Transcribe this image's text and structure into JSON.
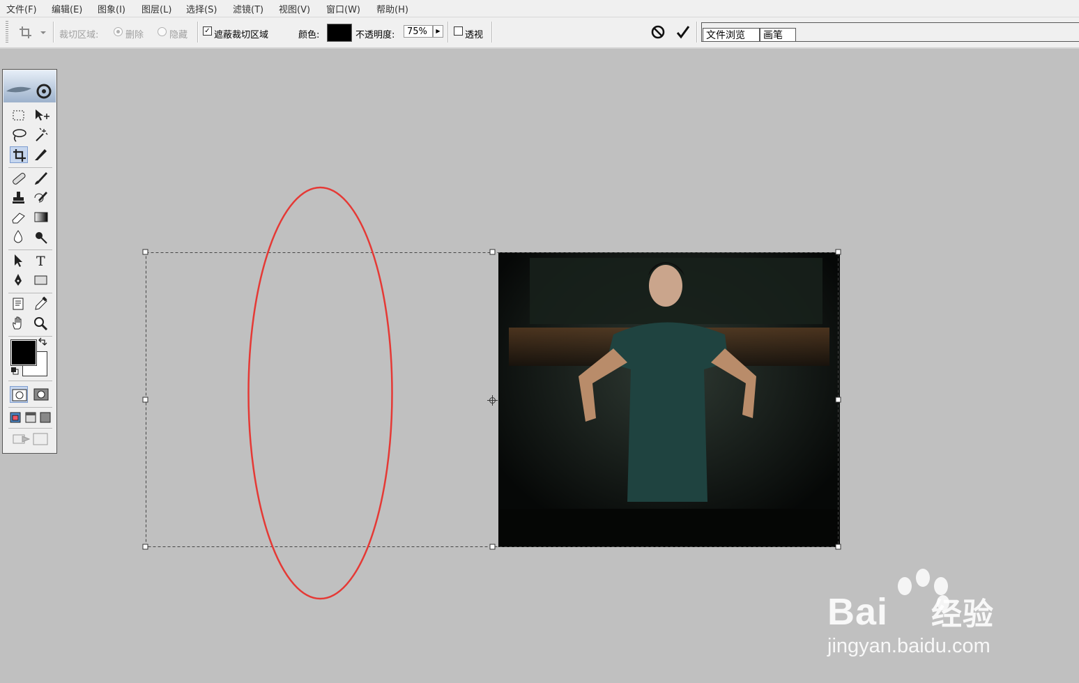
{
  "menu": [
    {
      "id": "file",
      "label": "文件(F)"
    },
    {
      "id": "edit",
      "label": "编辑(E)"
    },
    {
      "id": "image",
      "label": "图象(I)"
    },
    {
      "id": "layer",
      "label": "图层(L)"
    },
    {
      "id": "select",
      "label": "选择(S)"
    },
    {
      "id": "filter",
      "label": "滤镜(T)"
    },
    {
      "id": "view",
      "label": "视图(V)"
    },
    {
      "id": "window",
      "label": "窗口(W)"
    },
    {
      "id": "help",
      "label": "帮助(H)"
    }
  ],
  "options": {
    "crop_area_label": "裁切区域:",
    "delete_label": "删除",
    "hide_label": "隐藏",
    "shield_label": "遮蔽裁切区域",
    "shield_checked": true,
    "color_label": "颜色:",
    "shield_color": "#000000",
    "opacity_label": "不透明度:",
    "opacity_value": "75%",
    "perspective_label": "透视",
    "perspective_checked": false
  },
  "palette_well": {
    "tabs": [
      "文件浏览",
      "画笔"
    ]
  },
  "tools": [
    "marquee-tool",
    "move-tool",
    "lasso-tool",
    "magic-wand-tool",
    "crop-tool",
    "slice-tool",
    "healing-brush-tool",
    "brush-tool",
    "clone-stamp-tool",
    "history-brush-tool",
    "eraser-tool",
    "gradient-tool",
    "blur-tool",
    "dodge-tool",
    "path-select-tool",
    "type-tool",
    "pen-tool",
    "shape-tool",
    "notes-tool",
    "eyedropper-tool",
    "hand-tool",
    "zoom-tool"
  ],
  "active_tool": "crop-tool",
  "colors": {
    "foreground": "#000000",
    "background": "#ffffff",
    "annotation": "#e53935"
  },
  "watermark": {
    "brand": "Bai",
    "brand_tail": "经验",
    "url": "jingyan.baidu.com"
  }
}
